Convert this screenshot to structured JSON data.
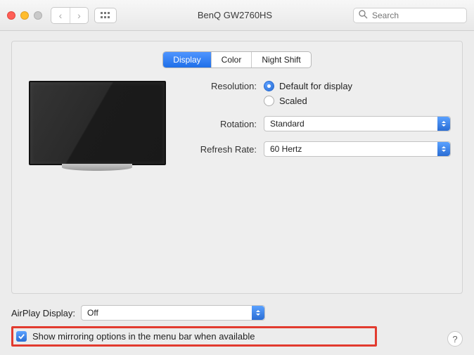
{
  "titlebar": {
    "title": "BenQ GW2760HS",
    "search_placeholder": "Search"
  },
  "tabs": {
    "display": "Display",
    "color": "Color",
    "night_shift": "Night Shift"
  },
  "settings": {
    "resolution_label": "Resolution:",
    "resolution_default": "Default for display",
    "resolution_scaled": "Scaled",
    "rotation_label": "Rotation:",
    "rotation_value": "Standard",
    "refresh_label": "Refresh Rate:",
    "refresh_value": "60 Hertz"
  },
  "bottom": {
    "airplay_label": "AirPlay Display:",
    "airplay_value": "Off",
    "mirror_label": "Show mirroring options in the menu bar when available",
    "help": "?"
  }
}
